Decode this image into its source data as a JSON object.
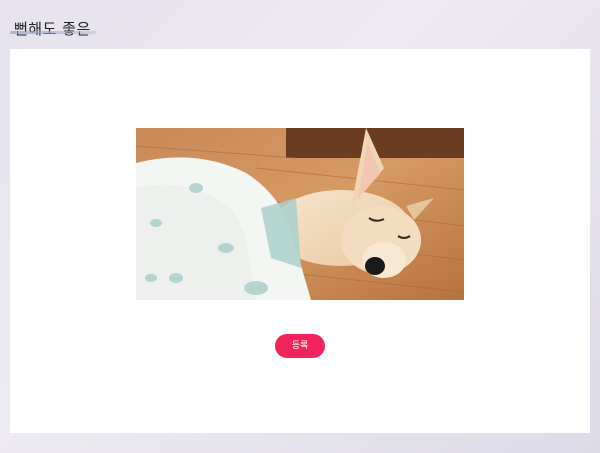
{
  "header": {
    "title": "뻔해도 좋은"
  },
  "main": {
    "photo_subject": "sleeping-dog-under-blanket",
    "register_label": "등록"
  },
  "colors": {
    "accent": "#f0245a",
    "card_bg": "#ffffff"
  }
}
